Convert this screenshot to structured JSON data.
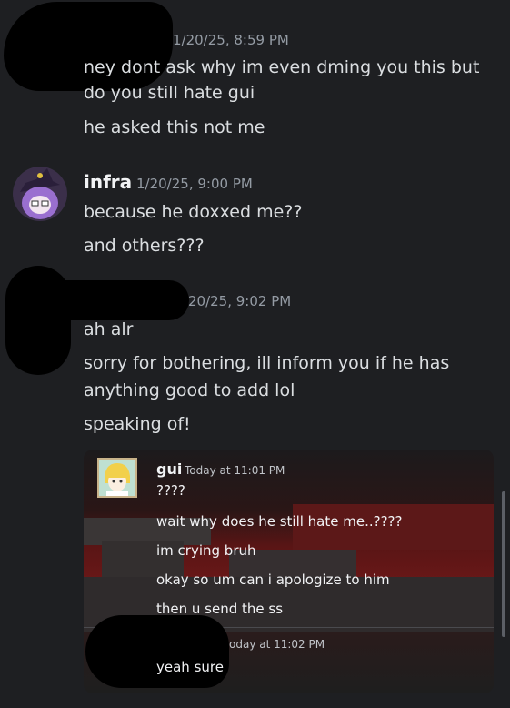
{
  "messages": [
    {
      "timestamp": "1/20/25, 8:59 PM",
      "lines": [
        "ney dont ask why im even dming you this but",
        "do you still hate gui",
        "he asked this not me"
      ]
    },
    {
      "author": "infra",
      "timestamp": "1/20/25, 9:00 PM",
      "lines": [
        "because he doxxed me??",
        "and others???"
      ]
    },
    {
      "timestamp": "20/25, 9:02 PM",
      "lines": [
        "ah alr",
        "sorry for bothering, ill inform you if he has",
        "anything good to add lol",
        "speaking of!"
      ]
    }
  ],
  "embed": {
    "author": "gui",
    "timestamp": "Today at 11:01 PM",
    "lines": [
      "????",
      "wait why does he still hate me..????",
      "im crying bruh",
      "okay so um can i apologize to him",
      "then u send the ss"
    ],
    "reply_timestamp": "oday at 11:02 PM",
    "reply_lines": [
      "yeah sure"
    ]
  }
}
